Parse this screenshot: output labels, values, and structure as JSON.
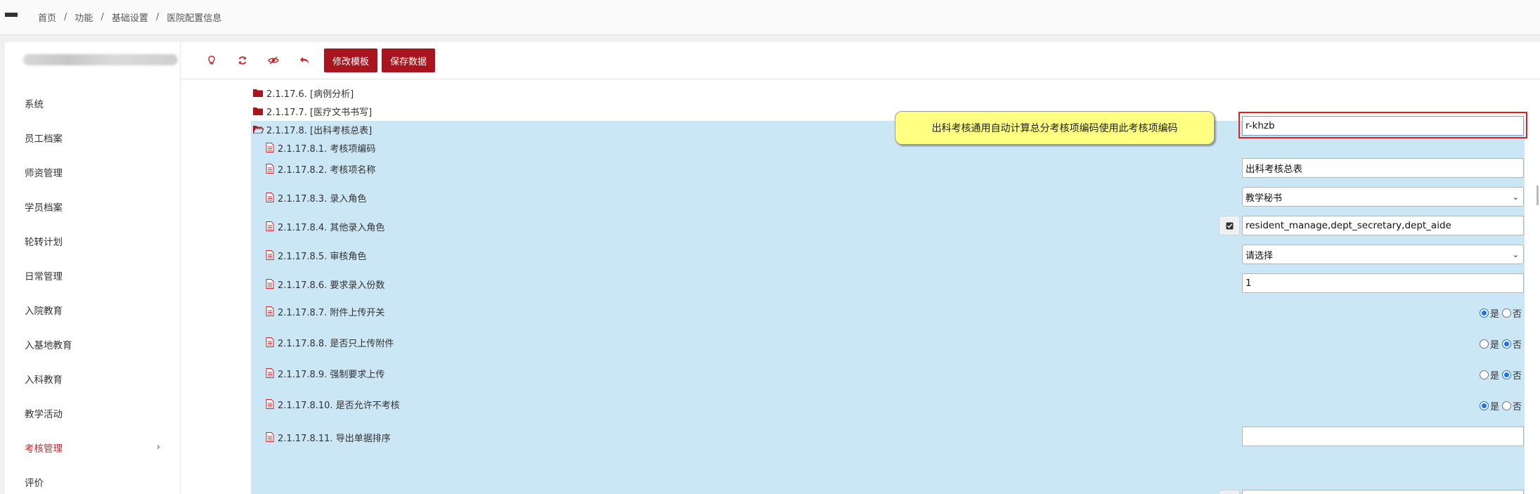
{
  "breadcrumb": [
    "首页",
    "功能",
    "基础设置",
    "医院配置信息"
  ],
  "breadcrumb_sep": "/",
  "sidebar": {
    "items": [
      {
        "label": "系统"
      },
      {
        "label": "员工档案"
      },
      {
        "label": "师资管理"
      },
      {
        "label": "学员档案"
      },
      {
        "label": "轮转计划"
      },
      {
        "label": "日常管理"
      },
      {
        "label": "入院教育"
      },
      {
        "label": "入基地教育"
      },
      {
        "label": "入科教育"
      },
      {
        "label": "教学活动"
      },
      {
        "label": "考核管理",
        "active": true,
        "chevron": "›"
      },
      {
        "label": "评价"
      }
    ]
  },
  "toolbar": {
    "icons": [
      "lightbulb-icon",
      "refresh-icon",
      "eye-slash-icon",
      "undo-icon"
    ],
    "edit_template_label": "修改模板",
    "save_data_label": "保存数据"
  },
  "tree": {
    "folders": [
      {
        "label": "2.1.17.6. [病例分析]",
        "open": false
      },
      {
        "label": "2.1.17.7. [医疗文书书写]",
        "open": false
      },
      {
        "label": "2.1.17.8. [出科考核总表]",
        "open": true
      }
    ],
    "items": [
      {
        "label": "2.1.17.8.1. 考核项编码",
        "kind": "text",
        "value": "r-khzb"
      },
      {
        "label": "2.1.17.8.2. 考核项名称",
        "kind": "text",
        "value": "出科考核总表"
      },
      {
        "label": "2.1.17.8.3. 录入角色",
        "kind": "select",
        "value": "教学秘书"
      },
      {
        "label": "2.1.17.8.4. 其他录入角色",
        "kind": "text",
        "value": "resident_manage,dept_secretary,dept_aide"
      },
      {
        "label": "2.1.17.8.5. 审核角色",
        "kind": "select",
        "value": "请选择"
      },
      {
        "label": "2.1.17.8.6. 要求录入份数",
        "kind": "text",
        "value": "1"
      },
      {
        "label": "2.1.17.8.7. 附件上传开关",
        "kind": "radio",
        "value": "是"
      },
      {
        "label": "2.1.17.8.8. 是否只上传附件",
        "kind": "radio",
        "value": "否"
      },
      {
        "label": "2.1.17.8.9. 强制要求上传",
        "kind": "radio",
        "value": "否"
      },
      {
        "label": "2.1.17.8.10. 是否允许不考核",
        "kind": "radio",
        "value": "是"
      },
      {
        "label": "2.1.17.8.11. 导出单据排序",
        "kind": "text",
        "value": ""
      }
    ],
    "radio_yes": "是",
    "radio_no": "否"
  },
  "tooltip": {
    "text": "出科考核通用自动计算总分考核项编码使用此考核项编码"
  },
  "colors": {
    "accent": "#c9252c",
    "button_bg": "#a8151f",
    "panel_bg": "#cbe6f5",
    "tooltip_bg": "#ffff82"
  }
}
